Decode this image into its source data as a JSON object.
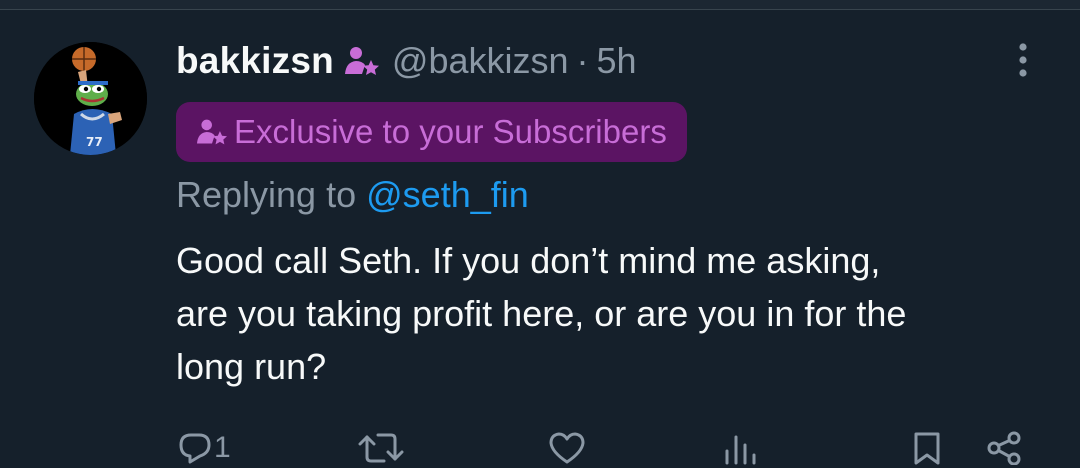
{
  "tweet": {
    "display_name": "bakkizsn",
    "handle": "@bakkizsn",
    "separator": "·",
    "time": "5h",
    "subscriber_icon": "subscriber-badge-icon",
    "exclusive_badge": {
      "icon": "subscriber-badge-icon",
      "label": "Exclusive to your Subscribers"
    },
    "replying_prefix": "Replying to",
    "replying_to": "@seth_fin",
    "text_lines": [
      "Good call Seth. If you don’t mind me asking,",
      "are you taking profit here, or are you in for the",
      "long run?"
    ],
    "actions": {
      "reply": {
        "icon": "reply-icon",
        "count": "1"
      },
      "retweet": {
        "icon": "retweet-icon",
        "count": ""
      },
      "like": {
        "icon": "heart-icon",
        "count": ""
      },
      "views": {
        "icon": "views-icon",
        "count": ""
      },
      "bookmark": {
        "icon": "bookmark-icon"
      },
      "share": {
        "icon": "share-icon"
      }
    }
  },
  "colors": {
    "background": "#15202b",
    "text_primary": "#f7f9f9",
    "text_secondary": "#8b98a5",
    "accent_blue": "#1d9bf0",
    "badge_bg": "#5b1463",
    "badge_text": "#c86dd7"
  }
}
